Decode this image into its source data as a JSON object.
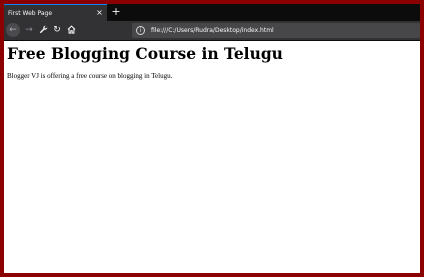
{
  "browser": {
    "tab": {
      "title": "First Web Page",
      "close_glyph": "×"
    },
    "new_tab_glyph": "+",
    "toolbar": {
      "back_icon": "arrow-left-icon",
      "forward_icon": "arrow-right-icon",
      "tools_icon": "wrench-icon",
      "reload_icon": "reload-icon",
      "home_icon": "home-icon"
    },
    "address_bar": {
      "info_icon": "info-icon",
      "url": "file:///C:/Users/Rudra/Desktop/index.html"
    }
  },
  "page": {
    "heading": "Free Blogging Course in Telugu",
    "paragraph": "Blogger VJ is offering a free course on blogging in Telugu."
  },
  "colors": {
    "frame_border": "#8b0000",
    "tab_bg": "#323234",
    "tabstrip_bg": "#0c0c0d",
    "urlbar_bg": "#474749",
    "page_bg": "#ffffff"
  }
}
